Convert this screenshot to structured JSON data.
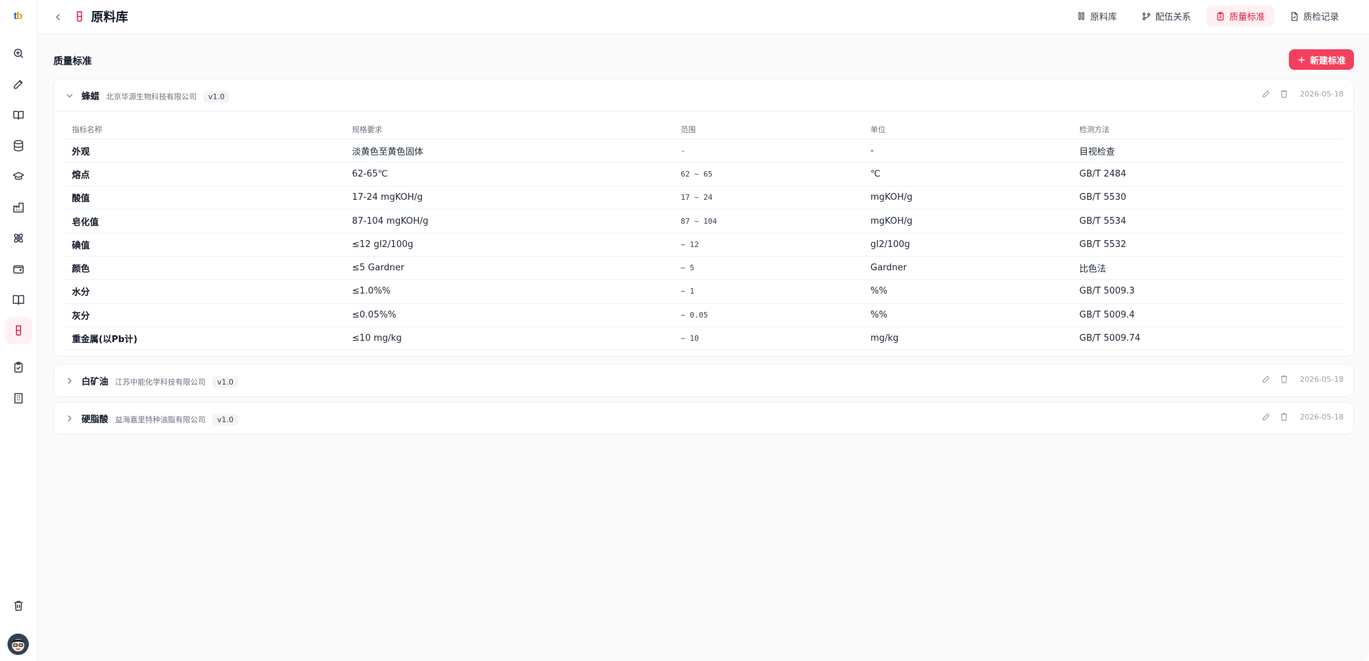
{
  "header": {
    "title": "原料库",
    "tabs": [
      {
        "label": "原料库",
        "active": false
      },
      {
        "label": "配伍关系",
        "active": false
      },
      {
        "label": "质量标准",
        "active": true
      },
      {
        "label": "质检记录",
        "active": false
      }
    ]
  },
  "logo": {
    "text": "tb"
  },
  "main": {
    "section_title": "质量标准",
    "new_button": "新建标准",
    "columns": [
      "指标名称",
      "规格要求",
      "范围",
      "单位",
      "检测方法"
    ],
    "standards": [
      {
        "name": "蜂蜡",
        "supplier": "北京华源生物科技有限公司",
        "version": "v1.0",
        "date": "2026-05-18",
        "expanded": true,
        "rows": [
          [
            "外观",
            "淡黄色至黄色固体",
            "-",
            "-",
            "目视检查"
          ],
          [
            "熔点",
            "62-65℃",
            "62 ~ 65",
            "℃",
            "GB/T 2484"
          ],
          [
            "酸值",
            "17-24 mgKOH/g",
            "17 ~ 24",
            "mgKOH/g",
            "GB/T 5530"
          ],
          [
            "皂化值",
            "87-104 mgKOH/g",
            "87 ~ 104",
            "mgKOH/g",
            "GB/T 5534"
          ],
          [
            "碘值",
            "≤12 gI2/100g",
            "~ 12",
            "gI2/100g",
            "GB/T 5532"
          ],
          [
            "颜色",
            "≤5 Gardner",
            "~ 5",
            "Gardner",
            "比色法"
          ],
          [
            "水分",
            "≤1.0%%",
            "~ 1",
            "%%",
            "GB/T 5009.3"
          ],
          [
            "灰分",
            "≤0.05%%",
            "~ 0.05",
            "%%",
            "GB/T 5009.4"
          ],
          [
            "重金属(以Pb计)",
            "≤10 mg/kg",
            "~ 10",
            "mg/kg",
            "GB/T 5009.74"
          ]
        ]
      },
      {
        "name": "白矿油",
        "supplier": "江苏中能化学科技有限公司",
        "version": "v1.0",
        "date": "2026-05-18",
        "expanded": false
      },
      {
        "name": "硬脂酸",
        "supplier": "益海嘉里特种油脂有限公司",
        "version": "v1.0",
        "date": "2026-05-18",
        "expanded": false
      }
    ]
  },
  "colors": {
    "accent": "#f43f5e",
    "accent_bg": "#fff0f2",
    "border": "#eceef1"
  },
  "icons": {
    "sidebar": [
      "search-icon",
      "edit-icon",
      "book-icon",
      "database-icon",
      "graduation-cap-icon",
      "factory-icon",
      "atom-icon",
      "wallet-icon",
      "book-open-icon",
      "test-tube-icon",
      "clipboard-check-icon",
      "building-icon",
      "trash-icon"
    ]
  }
}
